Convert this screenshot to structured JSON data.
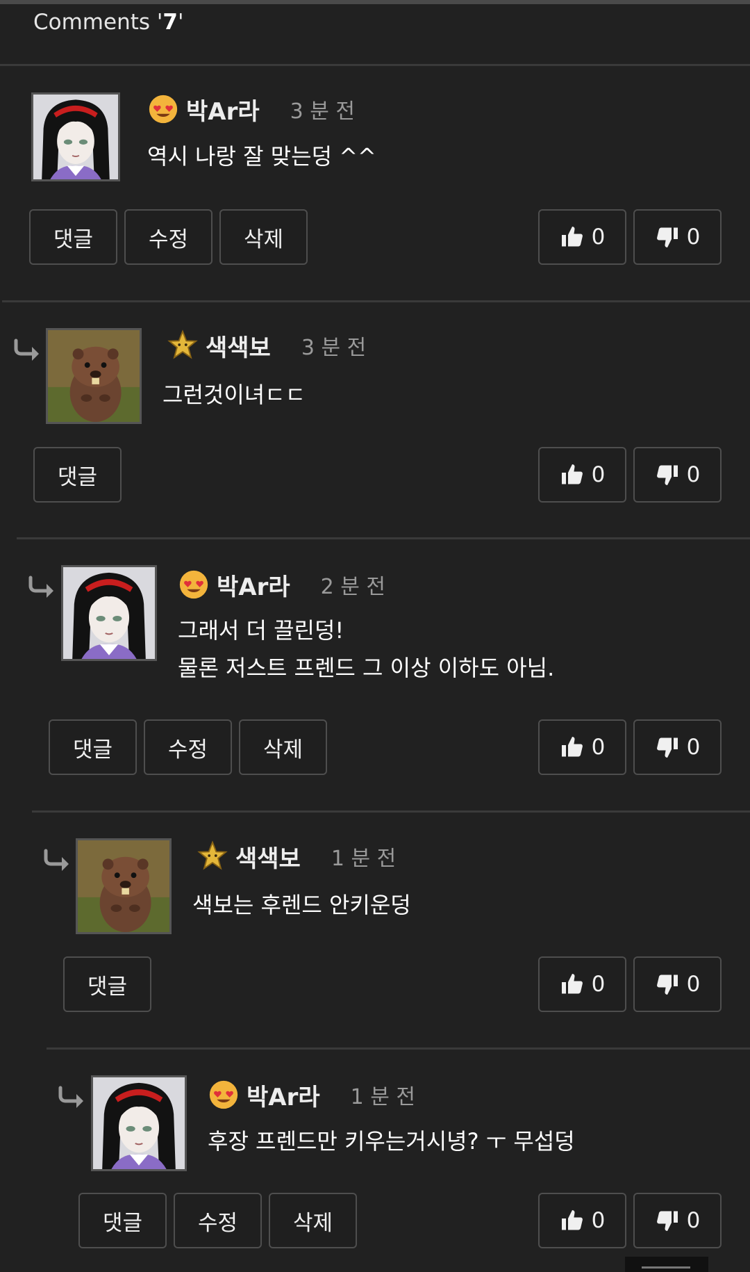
{
  "header": {
    "prefix": "Comments '",
    "count": "7",
    "suffix": "'"
  },
  "labels": {
    "reply": "댓글",
    "edit": "수정",
    "delete": "삭제"
  },
  "comments": [
    {
      "author": "박Ar라",
      "time": "3 분 전",
      "badge": "heart-eyes-emoji-icon",
      "lines": [
        "역시 나랑 잘 맞는덩 ^^"
      ],
      "likes": "0",
      "dislikes": "0"
    },
    {
      "author": "색색보",
      "time": "3 분 전",
      "badge": "star-icon",
      "lines": [
        "그런것이녀ㄷㄷ"
      ],
      "likes": "0",
      "dislikes": "0"
    },
    {
      "author": "박Ar라",
      "time": "2 분 전",
      "badge": "heart-eyes-emoji-icon",
      "lines": [
        "그래서 더 끌린덩!",
        "물론 저스트 프렌드 그 이상 이하도 아님."
      ],
      "likes": "0",
      "dislikes": "0"
    },
    {
      "author": "색색보",
      "time": "1 분 전",
      "badge": "star-icon",
      "lines": [
        "색보는 후렌드 안키운덩"
      ],
      "likes": "0",
      "dislikes": "0"
    },
    {
      "author": "박Ar라",
      "time": "1 분 전",
      "badge": "heart-eyes-emoji-icon",
      "lines": [
        "후장 프렌드만 키우는거시녕? ㅜ 무섭덩"
      ],
      "likes": "0",
      "dislikes": "0"
    }
  ],
  "colors": {
    "background": "#212121",
    "divider": "#3a3a3a",
    "button_border": "#4e4e4e",
    "time_text": "#9a9a9a"
  }
}
